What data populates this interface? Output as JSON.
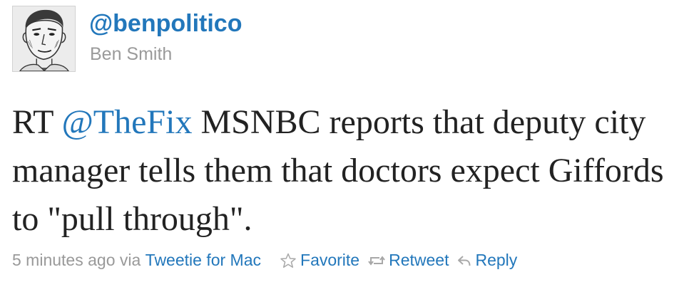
{
  "tweet": {
    "screen_name": "@benpolitico",
    "full_name": "Ben Smith",
    "text_before": "RT ",
    "mention": "@TheFix",
    "text_after": " MSNBC reports that deputy city manager tells them that doctors expect Giffords to \"pull through\".",
    "timestamp": "5 minutes ago",
    "via": "via",
    "client": "Tweetie for Mac"
  },
  "actions": {
    "favorite_label": "Favorite",
    "retweet_label": "Retweet",
    "reply_label": "Reply"
  },
  "icons": {
    "avatar": "sketch-portrait-avatar",
    "favorite": "star-outline-icon",
    "retweet": "retweet-arrows-icon",
    "reply": "reply-arrow-icon"
  },
  "colors": {
    "link": "#2277bb",
    "text": "#222222",
    "muted": "#999999",
    "background": "#ffffff"
  }
}
